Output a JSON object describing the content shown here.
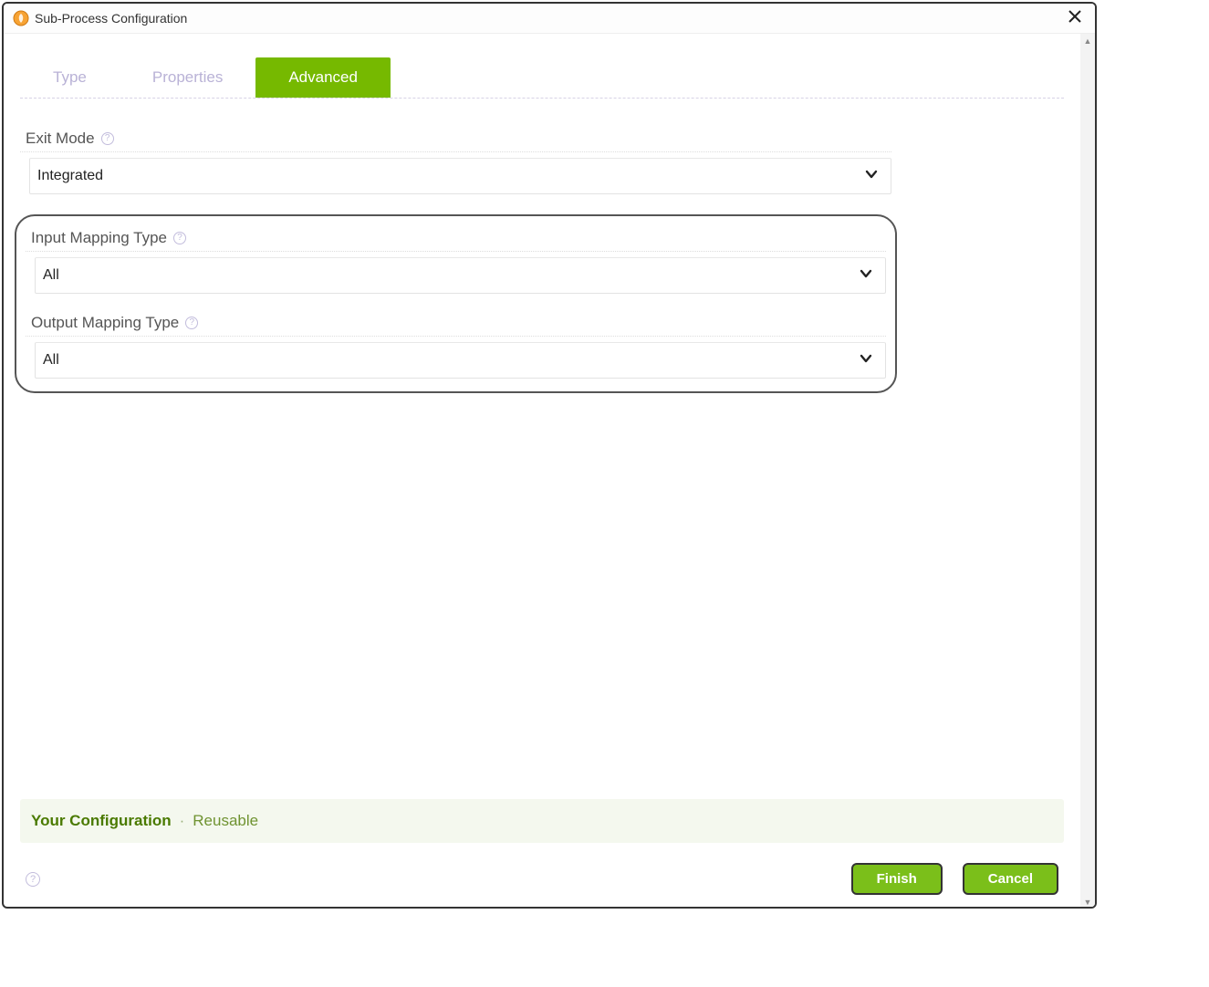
{
  "titlebar": {
    "title": "Sub-Process Configuration"
  },
  "tabs": {
    "type_label": "Type",
    "properties_label": "Properties",
    "advanced_label": "Advanced"
  },
  "form": {
    "exit_mode": {
      "label": "Exit Mode",
      "value": "Integrated"
    },
    "input_mapping": {
      "label": "Input Mapping Type",
      "value": "All"
    },
    "output_mapping": {
      "label": "Output Mapping Type",
      "value": "All"
    }
  },
  "summary": {
    "label": "Your Configuration",
    "value": "Reusable"
  },
  "footer": {
    "finish_label": "Finish",
    "cancel_label": "Cancel"
  },
  "glyphs": {
    "help": "?"
  }
}
